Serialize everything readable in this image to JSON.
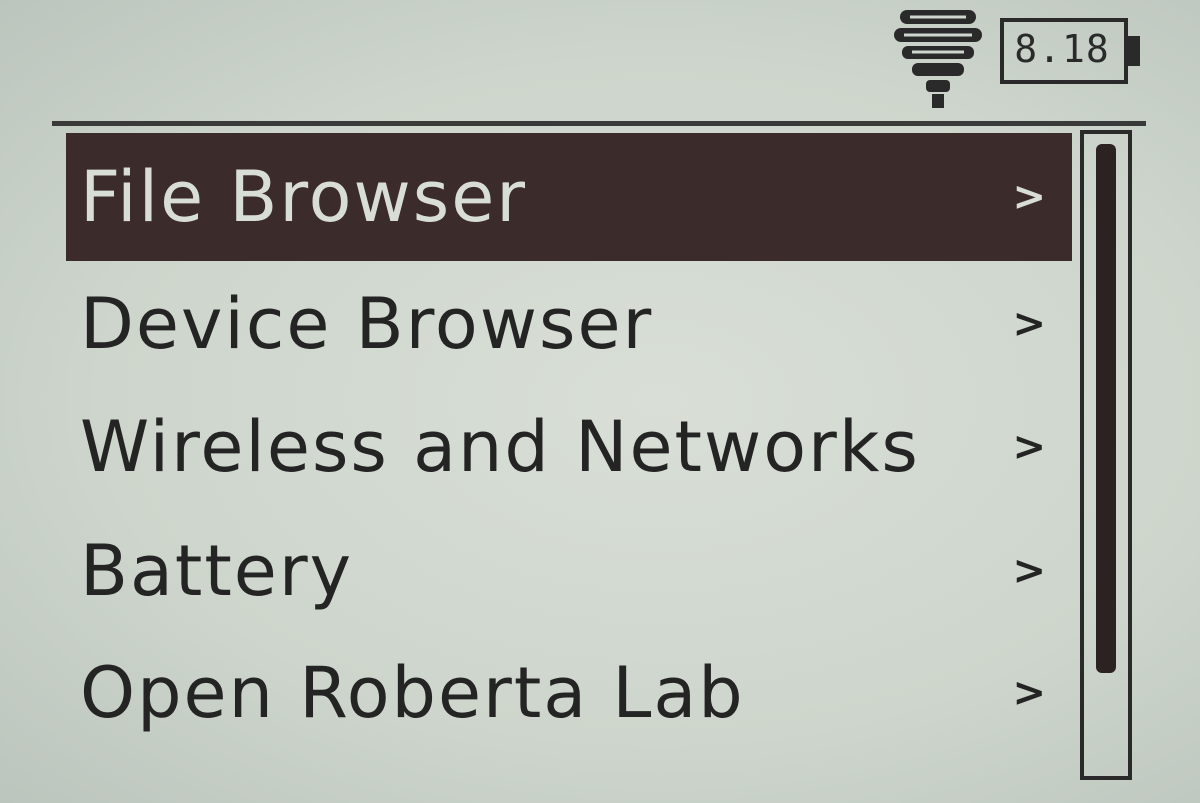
{
  "status_bar": {
    "wifi_icon": "wifi-icon",
    "battery_icon": "battery-icon",
    "battery_voltage": "8.18"
  },
  "menu": {
    "items": [
      {
        "label": "File Browser",
        "arrow": ">",
        "selected": true
      },
      {
        "label": "Device Browser",
        "arrow": ">",
        "selected": false
      },
      {
        "label": "Wireless and Networks",
        "arrow": ">",
        "selected": false
      },
      {
        "label": "Battery",
        "arrow": ">",
        "selected": false
      },
      {
        "label": "Open Roberta Lab",
        "arrow": ">",
        "selected": false
      }
    ]
  },
  "scrollbar": {
    "visible_fraction": 0.85
  },
  "colors": {
    "screen_background": "#cfd6cf",
    "foreground": "#242424",
    "selected_background": "#3b2b2b",
    "selected_foreground": "#d8ddd5"
  }
}
